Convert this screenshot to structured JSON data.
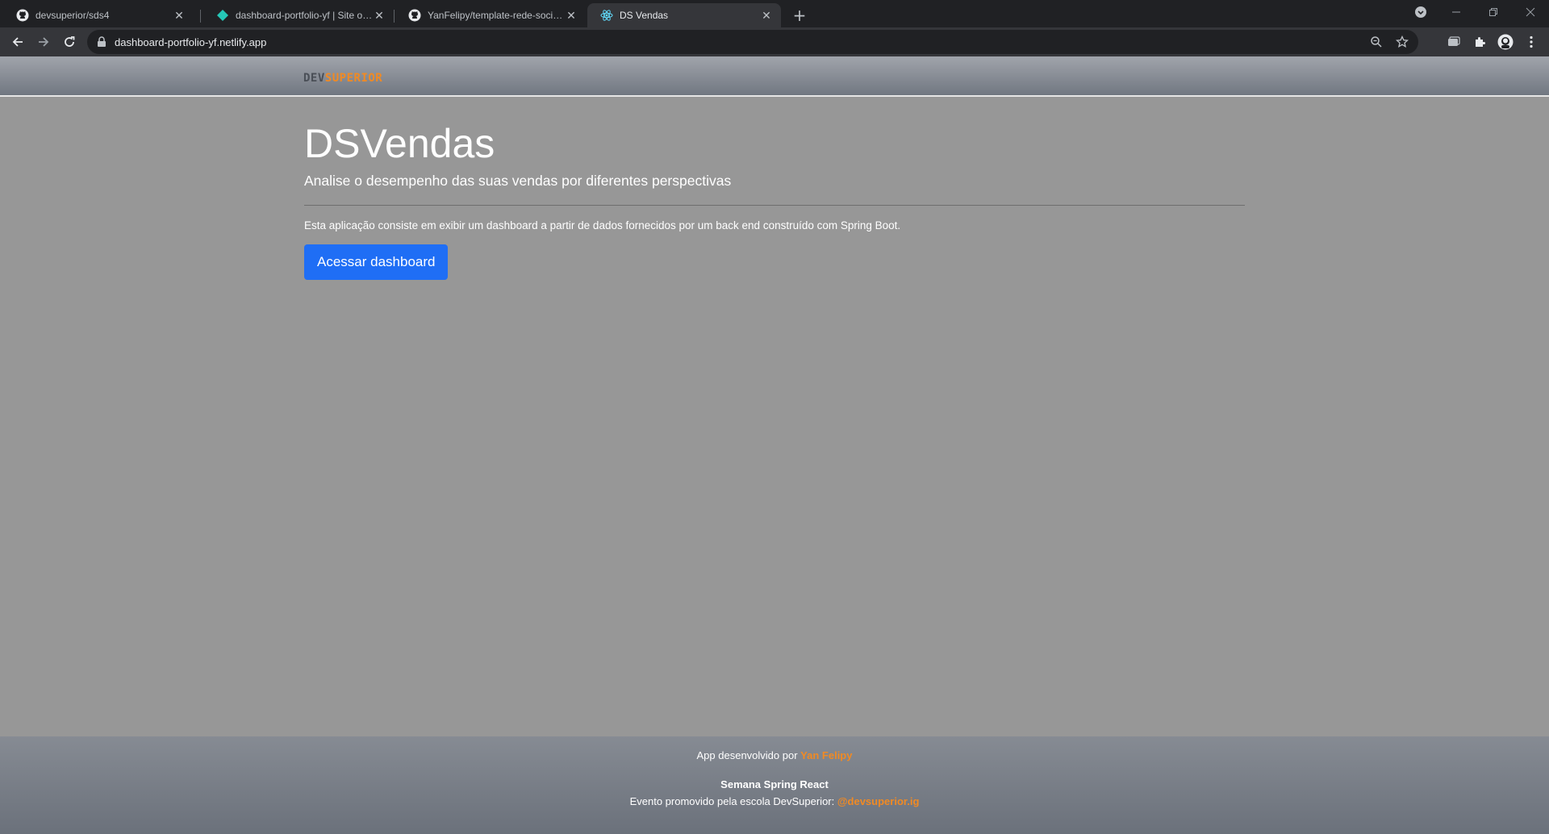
{
  "browser": {
    "tabs": [
      {
        "title": "devsuperior/sds4",
        "favicon": "github-icon"
      },
      {
        "title": "dashboard-portfolio-yf | Site overview",
        "favicon": "netlify-icon"
      },
      {
        "title": "YanFelipy/template-rede-social: Template de rede social",
        "favicon": "github-icon"
      },
      {
        "title": "DS Vendas",
        "favicon": "react-icon"
      }
    ],
    "url": "dashboard-portfolio-yf.netlify.app"
  },
  "header": {
    "logo_dev": "DEV",
    "logo_superior": "SUPERIOR"
  },
  "hero": {
    "title": "DSVendas",
    "subtitle": "Analise o desempenho das suas vendas por diferentes perspectivas",
    "description": "Esta aplicação consiste em exibir um dashboard a partir de dados fornecidos por um back end construído com Spring Boot.",
    "button_label": "Acessar dashboard"
  },
  "footer": {
    "line1_prefix": "App desenvolvido por ",
    "author": "Yan Felipy",
    "event": "Semana Spring React",
    "line3_prefix": "Evento promovido pela escola DevSuperior: ",
    "instagram": "@devsuperior.ig"
  },
  "colors": {
    "accent": "#f08a24",
    "button": "#1f6ef5",
    "page_bg": "#979797"
  }
}
